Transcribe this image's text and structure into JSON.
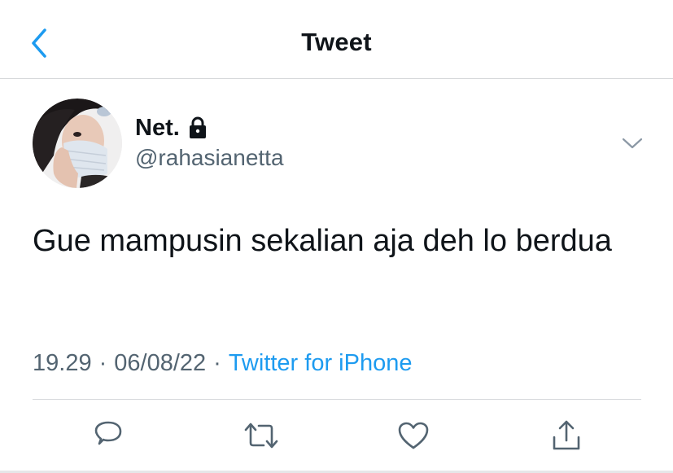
{
  "header": {
    "title": "Tweet",
    "back_icon": "chevron-left-icon"
  },
  "author": {
    "display_name": "Net.",
    "handle": "@rahasianetta",
    "protected_icon": "lock-icon",
    "more_icon": "chevron-down-icon"
  },
  "tweet": {
    "text": "Gue mampusin sekalian aja deh lo berdua",
    "time": "19.29",
    "date": "06/08/22",
    "separator": "·",
    "source": "Twitter for iPhone"
  },
  "actions": [
    {
      "name": "reply",
      "icon": "reply-icon"
    },
    {
      "name": "retweet",
      "icon": "retweet-icon"
    },
    {
      "name": "like",
      "icon": "heart-icon"
    },
    {
      "name": "share",
      "icon": "share-icon"
    }
  ],
  "colors": {
    "accent": "#1d9bf0",
    "secondary_text": "#536471",
    "primary_text": "#0f1419",
    "divider": "#d6d8db"
  }
}
